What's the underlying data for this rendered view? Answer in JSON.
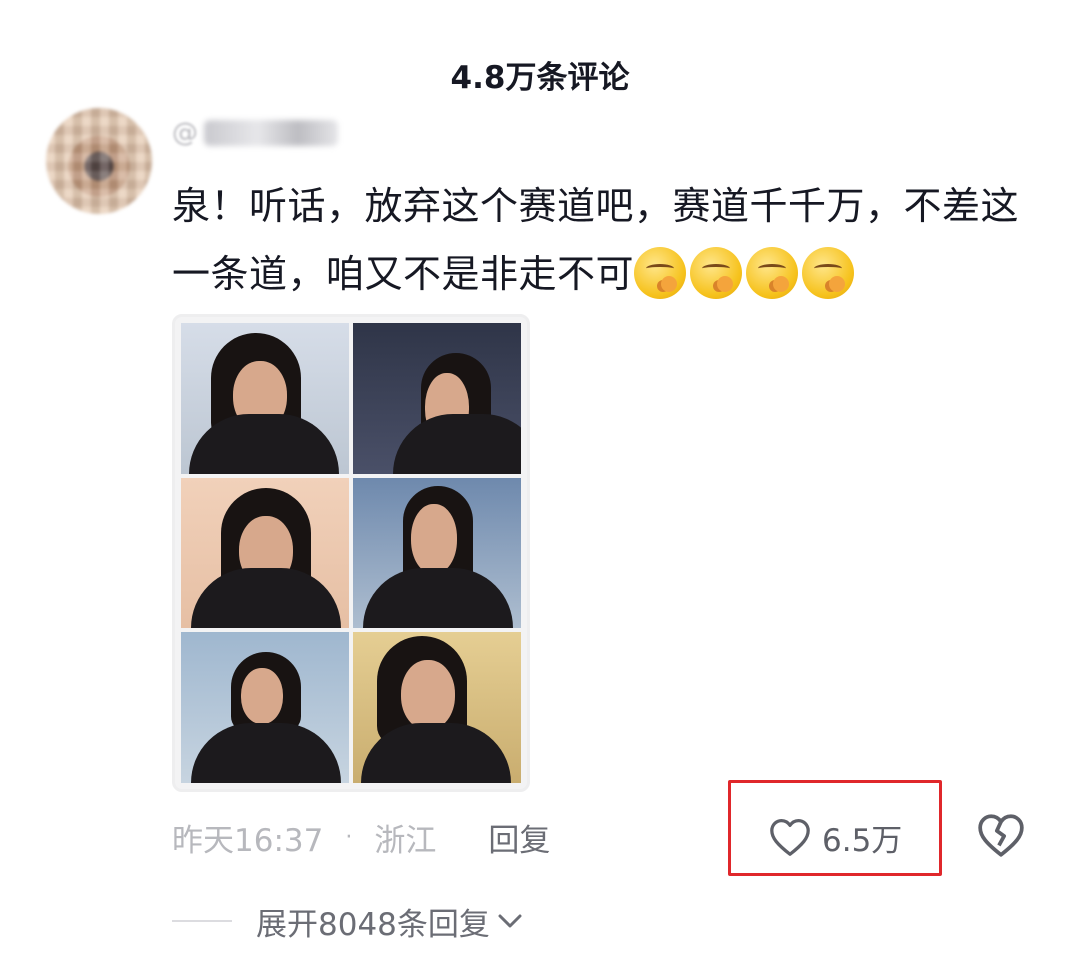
{
  "header": {
    "title": "4.8万条评论"
  },
  "comment": {
    "username_prefix": "@",
    "text": "泉！听话，放弃这个赛道吧，赛道千千万，不差这一条道，咱又不是非走不可",
    "emojis": [
      "shushing-face-emoji",
      "shushing-face-emoji",
      "shushing-face-emoji",
      "shushing-face-emoji"
    ],
    "timestamp": "昨天16:37",
    "separator": "·",
    "location": "浙江",
    "reply_label": "回复",
    "like_count": "6.5万",
    "expand_label": "展开8048条回复"
  },
  "colors": {
    "highlight_box": "#e0272b",
    "text_primary": "#161823",
    "text_secondary": "#b7b8bd"
  }
}
